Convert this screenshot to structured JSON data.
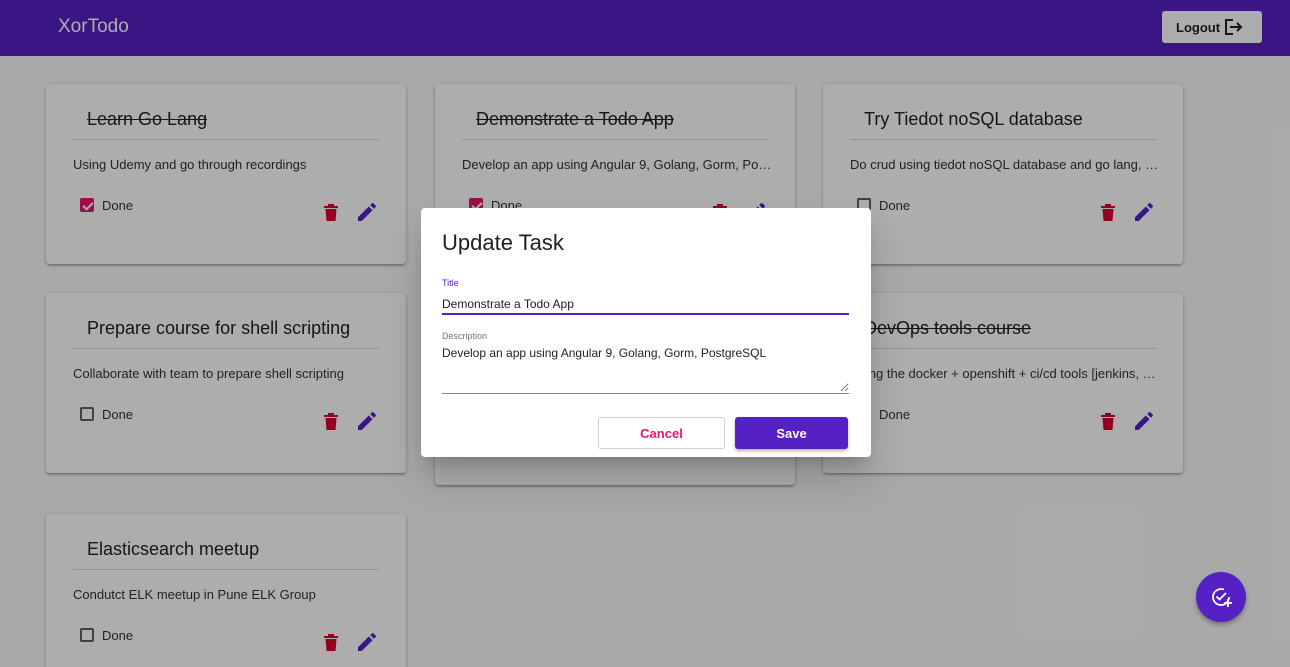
{
  "app": {
    "title": "XorTodo",
    "logout_label": "Logout"
  },
  "colors": {
    "primary": "#5521c3",
    "accent": "#e4176a",
    "delete": "#d6032e"
  },
  "tasks": [
    {
      "title": "Learn Go Lang",
      "description": "Using Udemy and go through recordings",
      "done_label": "Done",
      "done": true
    },
    {
      "title": "Demonstrate a Todo App",
      "description": "Develop an app using Angular 9, Golang, Gorm, PostgreSQL",
      "done_label": "Done",
      "done": true
    },
    {
      "title": "Try Tiedot noSQL database",
      "description": "Do crud using tiedot noSQL database and go lang, Python",
      "done_label": "Done",
      "done": false
    },
    {
      "title": "Prepare course for shell scripting",
      "description": "Collaborate with team to prepare shell scripting",
      "done_label": "Done",
      "done": false
    },
    {
      "title": "",
      "description": "",
      "done_label": "",
      "done": false
    },
    {
      "title": "DevOps tools course",
      "description": "Using the docker + openshift + ci/cd tools [jenkins, ansible]",
      "done_label": "Done",
      "done": true
    },
    {
      "title": "Elasticsearch meetup",
      "description": "Condutct ELK meetup in Pune ELK Group",
      "done_label": "Done",
      "done": false
    }
  ],
  "dialog": {
    "heading": "Update Task",
    "title_label": "Title",
    "title_value": "Demonstrate a Todo App",
    "description_label": "Description",
    "description_value": "Develop an app using Angular 9, Golang, Gorm, PostgreSQL",
    "cancel_label": "Cancel",
    "save_label": "Save"
  },
  "icons": {
    "logout": "logout-icon",
    "delete": "trash-icon",
    "edit": "pencil-icon",
    "add_task": "add-task-icon"
  }
}
